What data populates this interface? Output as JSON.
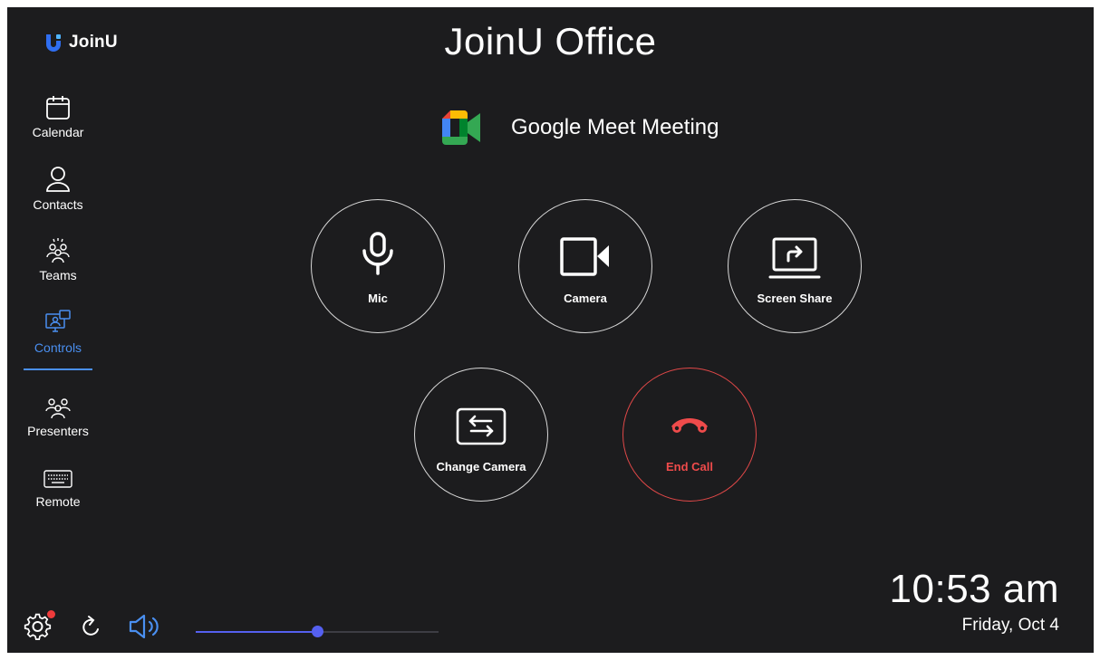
{
  "app": {
    "brand": "JoinU",
    "title": "JoinU Office",
    "brand_color": "#2f6ef0"
  },
  "sidebar": {
    "items": [
      {
        "label": "Calendar",
        "icon": "calendar-icon",
        "active": false
      },
      {
        "label": "Contacts",
        "icon": "person-icon",
        "active": false
      },
      {
        "label": "Teams",
        "icon": "team-icon",
        "active": false
      },
      {
        "label": "Controls",
        "icon": "monitor-control-icon",
        "active": true
      },
      {
        "label": "Presenters",
        "icon": "presenters-icon",
        "active": false
      },
      {
        "label": "Remote",
        "icon": "keyboard-icon",
        "active": false
      }
    ],
    "active_color": "#4a8ff0"
  },
  "meeting": {
    "name": "Google Meet Meeting",
    "icon": "google-meet-icon"
  },
  "controls": {
    "mic": {
      "label": "Mic",
      "icon": "microphone-icon"
    },
    "camera": {
      "label": "Camera",
      "icon": "video-camera-icon"
    },
    "screen_share": {
      "label": "Screen Share",
      "icon": "screen-share-icon"
    },
    "change_camera": {
      "label": "Change Camera",
      "icon": "switch-camera-icon"
    },
    "end_call": {
      "label": "End Call",
      "icon": "phone-hangup-icon",
      "color": "#ef4b4b"
    }
  },
  "footer": {
    "settings_icon": "gear-icon",
    "settings_notification": true,
    "refresh_icon": "refresh-icon",
    "volume_icon": "speaker-icon",
    "volume_level": 0.5,
    "volume_color": "#5560f0"
  },
  "clock": {
    "time": "10:53 am",
    "date": "Friday, Oct 4"
  }
}
